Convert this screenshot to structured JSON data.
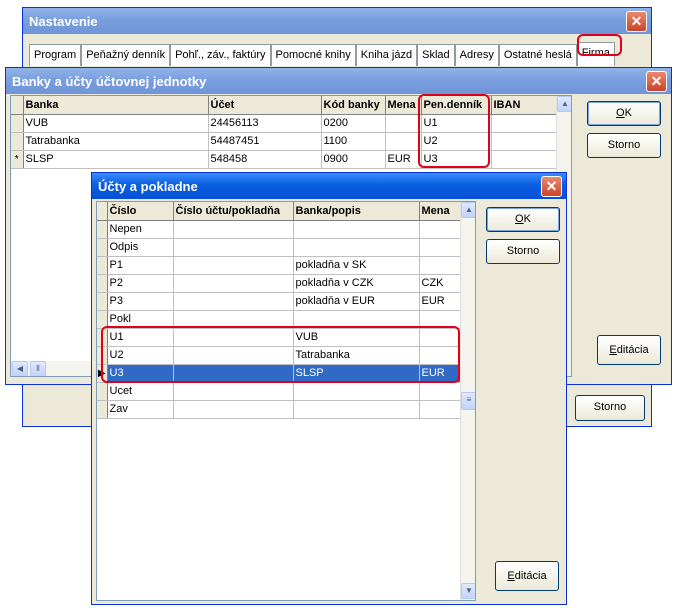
{
  "settings_window": {
    "title": "Nastavenie",
    "tabs": [
      "Program",
      "Peňažný denník",
      "Pohľ., záv., faktúry",
      "Pomocné knihy",
      "Kniha jázd",
      "Sklad",
      "Adresy",
      "Ostatné heslá",
      "Firma"
    ],
    "selected_tab": "Firma"
  },
  "banks_window": {
    "title": "Banky a účty účtovnej jednotky",
    "columns": [
      "Banka",
      "Účet",
      "Kód banky",
      "Mena",
      "Pen.denník",
      "IBAN"
    ],
    "rows": [
      [
        "VUB",
        "24456113",
        "0200",
        "",
        "U1",
        ""
      ],
      [
        "Tatrabanka",
        "54487451",
        "1100",
        "",
        "U2",
        ""
      ],
      [
        "SLSP",
        "548458",
        "0900",
        "EUR",
        "U3",
        ""
      ]
    ],
    "new_row_marker": "*",
    "ok_label": "OK",
    "ok_mnemonic": "O",
    "ok_rest": "K",
    "storno_label": "Storno",
    "editacia_label": "Editácia",
    "editacia_mnemonic": "E",
    "editacia_rest": "ditácia",
    "storno_bottom_label": "Storno"
  },
  "accounts_window": {
    "title": "Účty a pokladne",
    "columns": [
      "Číslo",
      "Číslo účtu/pokladňa",
      "Banka/popis",
      "Mena"
    ],
    "rows": [
      [
        "Nepen",
        "",
        "",
        ""
      ],
      [
        "Odpis",
        "",
        "",
        ""
      ],
      [
        "P1",
        "",
        "pokladňa v SK",
        ""
      ],
      [
        "P2",
        "",
        "pokladňa v CZK",
        "CZK"
      ],
      [
        "P3",
        "",
        "pokladňa v EUR",
        "EUR"
      ],
      [
        "Pokl",
        "",
        "",
        ""
      ],
      [
        "U1",
        "",
        "VUB",
        ""
      ],
      [
        "U2",
        "",
        "Tatrabanka",
        ""
      ],
      [
        "U3",
        "",
        "SLSP",
        "EUR"
      ],
      [
        "Ucet",
        "",
        "",
        ""
      ],
      [
        "Zav",
        "",
        "",
        ""
      ]
    ],
    "selected_row": 8,
    "row_pointer": "▶",
    "ok_mnemonic": "O",
    "ok_rest": "K",
    "storno_label": "Storno",
    "editacia_mnemonic": "E",
    "editacia_rest": "ditácia"
  },
  "colors": {
    "highlight": "#e0001a",
    "selection": "#316ac5",
    "title_active": "#0a5fe0",
    "title_inactive": "#7a9fdf"
  }
}
